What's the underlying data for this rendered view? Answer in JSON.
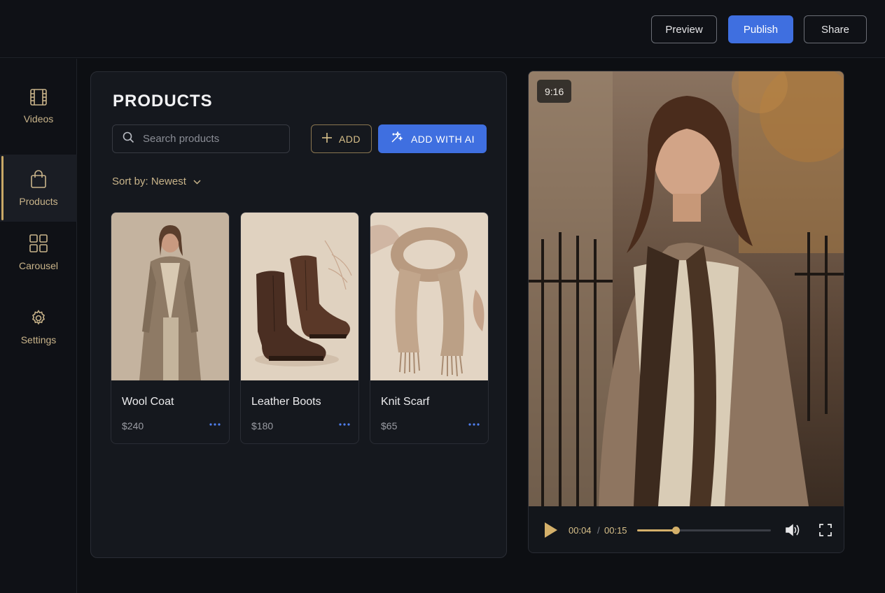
{
  "colors": {
    "accent": "#3f6fe0",
    "gold": "#c9a866",
    "background": "#0d0f13",
    "panel": "#15181e"
  },
  "topbar": {
    "preview_label": "Preview",
    "publish_label": "Publish",
    "share_label": "Share"
  },
  "sidebar": {
    "items": [
      {
        "label": "Videos",
        "icon": "film-icon",
        "active": false
      },
      {
        "label": "Products",
        "icon": "shopping-bag-icon",
        "active": true
      },
      {
        "label": "Carousel",
        "icon": "grid-icon",
        "active": false
      },
      {
        "label": "Settings",
        "icon": "gear-icon",
        "active": false
      }
    ]
  },
  "products": {
    "title": "PRODUCTS",
    "search_placeholder": "Search products",
    "add_label": "ADD",
    "add_ai_label": "ADD WITH AI",
    "sort_label": "Sort by: Newest",
    "items": [
      {
        "name": "Wool Coat",
        "price": "$240",
        "image": "wool-coat-photo"
      },
      {
        "name": "Leather Boots",
        "price": "$180",
        "image": "leather-boots-photo"
      },
      {
        "name": "Knit Scarf",
        "price": "$65",
        "image": "knit-scarf-photo"
      }
    ]
  },
  "video": {
    "aspect_ratio": "9:16",
    "current_time": "00:04",
    "separator": "/",
    "total_time": "00:15",
    "progress_fraction": 0.29
  }
}
